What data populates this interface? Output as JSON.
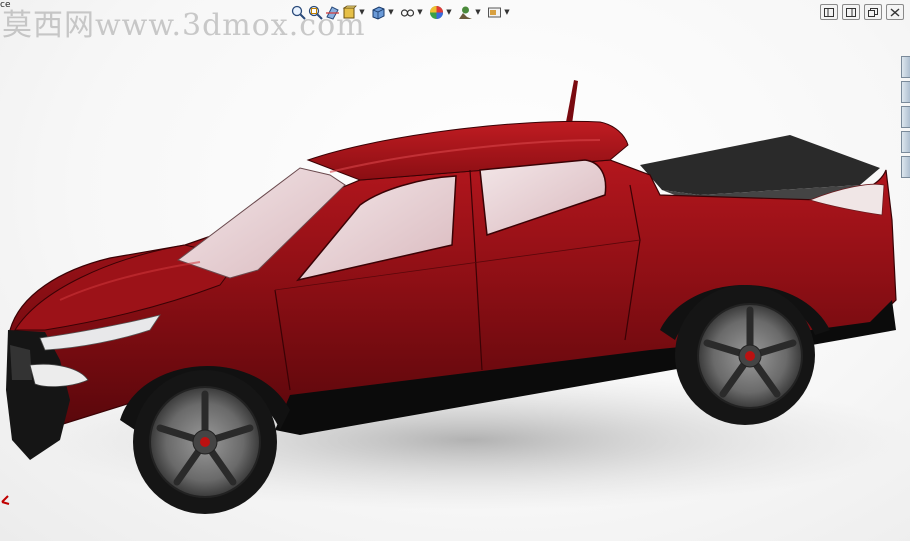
{
  "watermark": {
    "text": "莫西网www.3dmox.com"
  },
  "tab_fragment": {
    "text": "ce"
  },
  "heads_up_toolbar": {
    "items": [
      {
        "name": "zoom-to-fit",
        "icon": "zoom-to-fit-icon"
      },
      {
        "name": "zoom-to-area",
        "icon": "zoom-area-icon"
      },
      {
        "name": "section-view",
        "icon": "section-view-icon"
      },
      {
        "name": "view-orientation",
        "icon": "view-orientation-icon",
        "has_dropdown": true
      },
      {
        "name": "display-style",
        "icon": "display-style-icon",
        "has_dropdown": true
      },
      {
        "name": "hide-show-items",
        "icon": "hide-show-icon",
        "has_dropdown": true
      },
      {
        "name": "edit-appearance",
        "icon": "appearance-icon",
        "has_dropdown": true
      },
      {
        "name": "apply-scene",
        "icon": "scene-icon",
        "has_dropdown": true
      },
      {
        "name": "view-settings",
        "icon": "view-settings-icon",
        "has_dropdown": true
      }
    ]
  },
  "window_controls": {
    "buttons": [
      {
        "name": "tile-left",
        "icon": "tile-icon"
      },
      {
        "name": "tile-right",
        "icon": "tile-icon"
      },
      {
        "name": "restore",
        "icon": "restore-icon"
      },
      {
        "name": "close",
        "icon": "close-icon"
      }
    ]
  },
  "model": {
    "name": "pickup truck",
    "body_color": "#8b0d12",
    "tonneau_color": "#2a2a2a",
    "glass_color": "#e9d4d7"
  },
  "colors": {
    "toolbar_dropdown": "#333333",
    "watermark": "#a0a0a0",
    "triad_axis": "#c00000"
  }
}
